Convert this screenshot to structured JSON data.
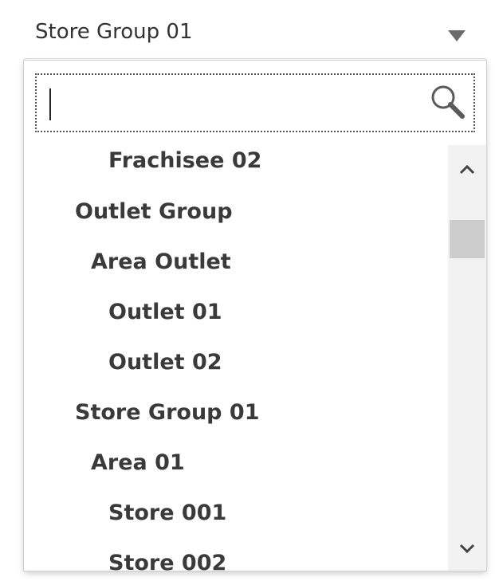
{
  "combo": {
    "selected_value": "Store Group 01",
    "icon": "triangle-down-icon"
  },
  "search": {
    "value": "",
    "placeholder": "",
    "icon": "search-icon"
  },
  "tree": {
    "items": [
      {
        "label": "Frachisee 02",
        "level": 3
      },
      {
        "label": "Outlet Group",
        "level": 1
      },
      {
        "label": "Area Outlet",
        "level": 2
      },
      {
        "label": "Outlet 01",
        "level": 3
      },
      {
        "label": "Outlet 02",
        "level": 3
      },
      {
        "label": "Store Group 01",
        "level": 1
      },
      {
        "label": "Area 01",
        "level": 2
      },
      {
        "label": "Store 001",
        "level": 3
      },
      {
        "label": "Store 002",
        "level": 3
      }
    ]
  },
  "scrollbar": {
    "up_icon": "chevron-up-icon",
    "down_icon": "chevron-down-icon"
  }
}
